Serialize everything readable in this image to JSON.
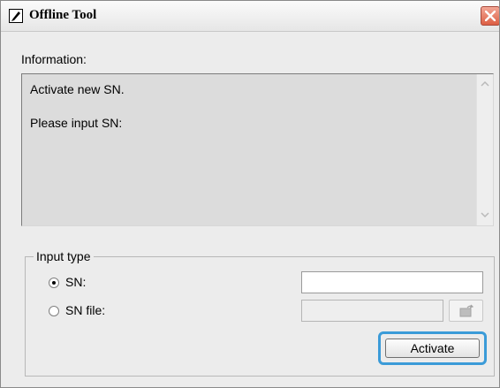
{
  "window": {
    "title": "Offline Tool",
    "app_icon": "pen-document-icon",
    "close_icon": "close-icon"
  },
  "information": {
    "label": "Information:",
    "lines": [
      "Activate new SN.",
      "Please input SN:"
    ]
  },
  "input_type": {
    "legend": "Input type",
    "sn": {
      "label": "SN:",
      "selected": true,
      "value": ""
    },
    "sn_file": {
      "label": "SN file:",
      "selected": false,
      "value": ""
    }
  },
  "buttons": {
    "browse_icon": "folder-open-icon",
    "activate": "Activate"
  },
  "colors": {
    "focus_highlight": "#3b9bd8",
    "close_button": "#dd5f44",
    "window_bg": "#ececec",
    "info_bg": "#dcdcdc"
  }
}
